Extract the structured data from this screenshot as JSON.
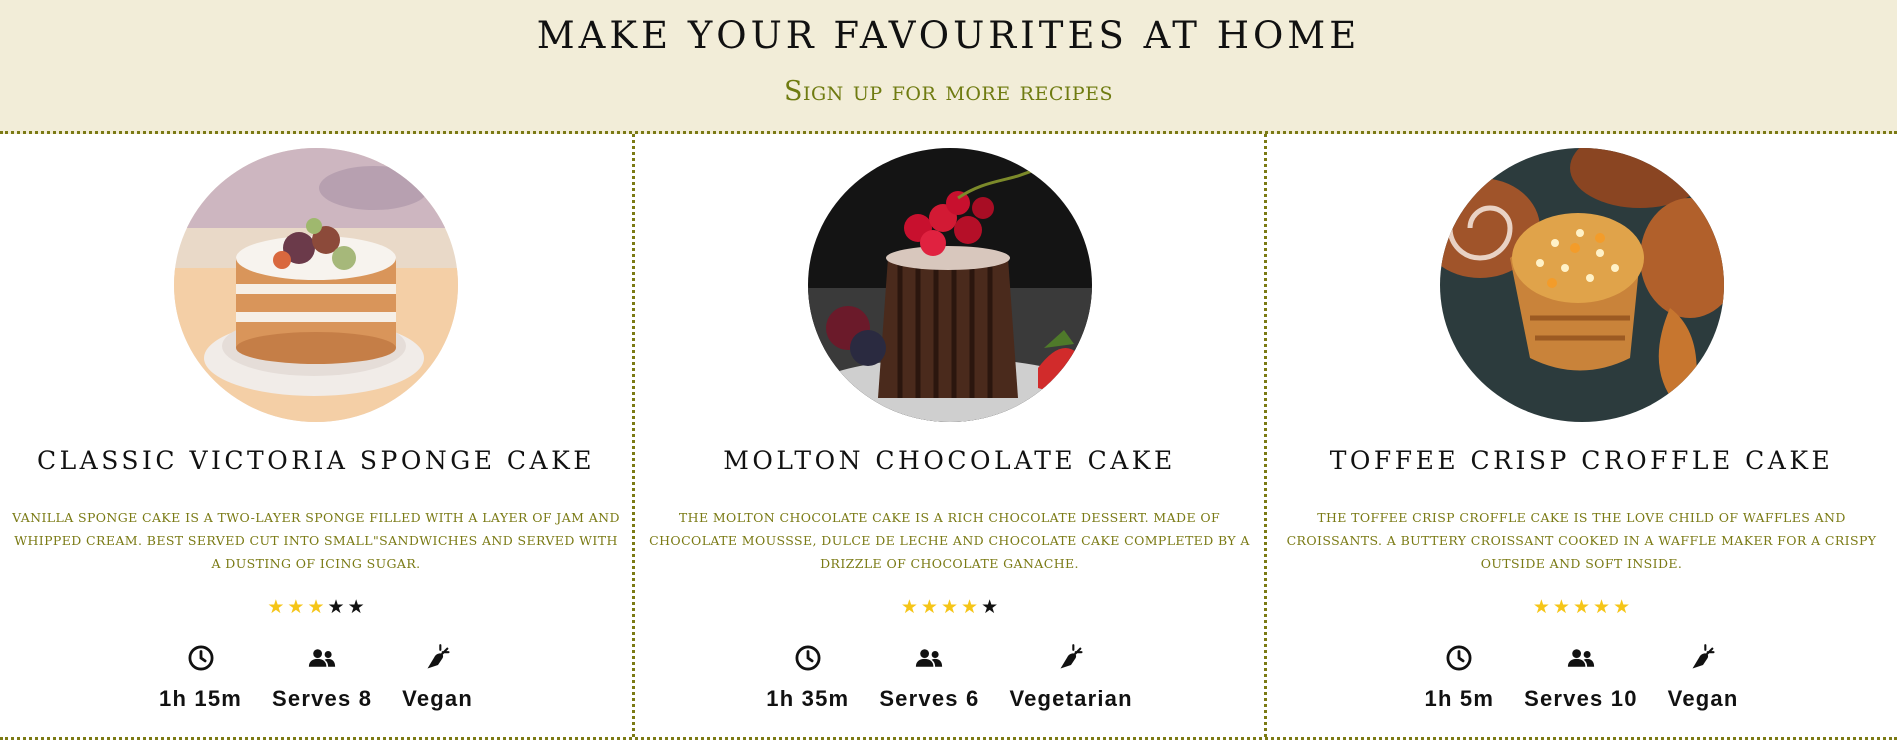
{
  "hero": {
    "title": "MAKE YOUR FAVOURITES AT HOME",
    "subtitle": "Sign up for more recipes"
  },
  "colors": {
    "hero_bg": "#f2edd8",
    "accent_olive": "#7b7a14",
    "star_on": "#f5c518",
    "star_off": "#111111"
  },
  "cards": [
    {
      "title": "CLASSIC VICTORIA SPONGE CAKE",
      "description": "Vanilla sponge cake is a two-layer sponge filled with a layer of jam and whipped cream. Best served cut into small\"sandwiches and served with a dusting of icing sugar.",
      "image": "victoria-sponge-cake-photo",
      "rating": 3,
      "rating_max": 5,
      "time": "1h 15m",
      "serves": "Serves 8",
      "diet": "Vegan",
      "icons": [
        "clock-icon",
        "users-icon",
        "carrot-icon"
      ]
    },
    {
      "title": "MOLTON CHOCOLATE CAKE",
      "description": "The molton chocolate cake is a rich chocolate dessert. Made of chocolate moussse, dulce de leche and chocolate cake completed by a drizzle of chocolate ganache.",
      "image": "molton-chocolate-cake-photo",
      "rating": 4,
      "rating_max": 5,
      "time": "1h 35m",
      "serves": "Serves 6",
      "diet": "Vegetarian",
      "icons": [
        "clock-icon",
        "users-icon",
        "carrot-icon"
      ]
    },
    {
      "title": "TOFFEE CRISP CROFFLE CAKE",
      "description": "The toffee crisp croffle cake is the love child of waffles and croissants. A buttery croissant cooked in a waffle maker for a crispy outside and soft inside.",
      "image": "toffee-croffle-photo",
      "rating": 5,
      "rating_max": 5,
      "time": "1h 5m",
      "serves": "Serves 10",
      "diet": "Vegan",
      "icons": [
        "clock-icon",
        "users-icon",
        "carrot-icon"
      ]
    }
  ]
}
